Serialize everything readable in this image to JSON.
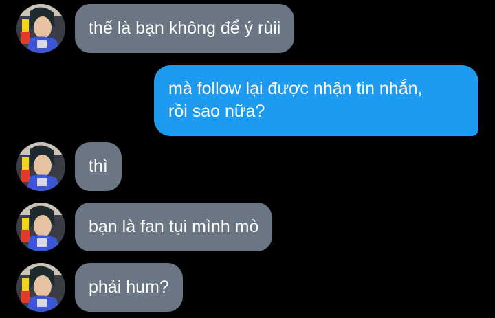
{
  "conversation": {
    "messages": [
      {
        "direction": "incoming",
        "text": "thế là bạn không để ý rùii"
      },
      {
        "direction": "outgoing",
        "lines": [
          "mà follow lại được nhận tin nhắn,",
          "rồi sao nữa?"
        ]
      },
      {
        "direction": "incoming",
        "text": "thì"
      },
      {
        "direction": "incoming",
        "text": "bạn là fan tụi mình mò"
      },
      {
        "direction": "incoming",
        "text": "phải hum?"
      }
    ]
  },
  "colors": {
    "background": "#000000",
    "incoming_bubble": "#6a7683",
    "outgoing_bubble": "#1d9bf0",
    "text": "#ffffff"
  },
  "icons": {
    "avatar": "contact-avatar-photo"
  }
}
